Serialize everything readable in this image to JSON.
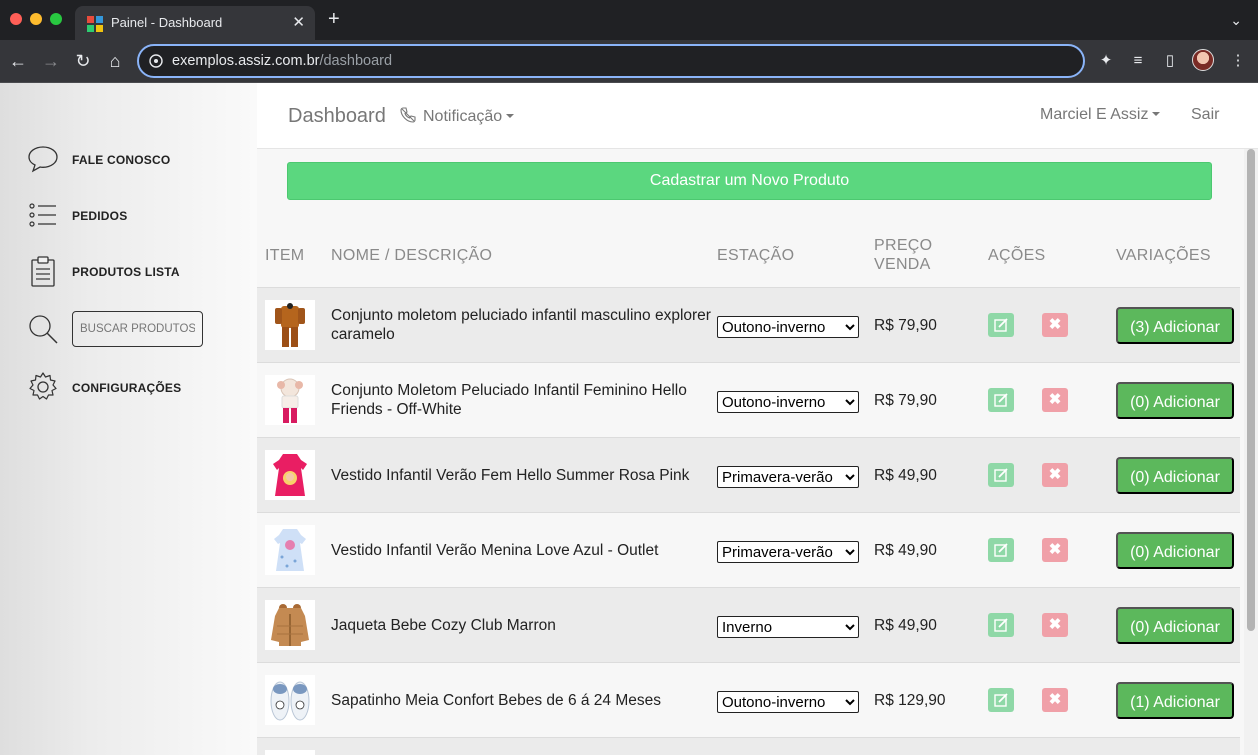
{
  "browser": {
    "tab_title": "Painel - Dashboard",
    "url_host": "exemplos.assiz.com.br",
    "url_path": "/dashboard"
  },
  "sidebar": {
    "items": [
      {
        "label": "FALE CONOSCO",
        "icon": "chat-bubble-icon"
      },
      {
        "label": "PEDIDOS",
        "icon": "list-icon"
      },
      {
        "label": "PRODUTOS LISTA",
        "icon": "clipboard-icon"
      },
      {
        "label": "CONFIGURAÇÕES",
        "icon": "gear-icon"
      }
    ],
    "search_placeholder": "BUSCAR PRODUTOS..."
  },
  "navbar": {
    "brand": "Dashboard",
    "notification_label": "Notificação",
    "user_label": "Marciel E Assiz",
    "logout_label": "Sair"
  },
  "cta_label": "Cadastrar um Novo Produto",
  "table": {
    "headers": {
      "item": "ITEM",
      "name": "NOME / DESCRIÇÃO",
      "season": "ESTAÇÃO",
      "price_line1": "PREÇO",
      "price_line2": "VENDA",
      "actions": "AÇÕES",
      "variations": "VARIAÇÕES"
    },
    "rows": [
      {
        "name": "Conjunto moletom peluciado infantil masculino explorer caramelo",
        "season": "Outono-inverno",
        "price": "R$ 79,90",
        "variations": "(3) Adicionar"
      },
      {
        "name": "Conjunto Moletom Peluciado Infantil Feminino Hello Friends - Off-White",
        "season": "Outono-inverno",
        "price": "R$ 79,90",
        "variations": "(0) Adicionar"
      },
      {
        "name": "Vestido Infantil Verão Fem Hello Summer Rosa Pink",
        "season": "Primavera-verão",
        "price": "R$ 49,90",
        "variations": "(0) Adicionar"
      },
      {
        "name": "Vestido Infantil Verão Menina Love Azul - Outlet",
        "season": "Primavera-verão",
        "price": "R$ 49,90",
        "variations": "(0) Adicionar"
      },
      {
        "name": "Jaqueta Bebe Cozy Club Marron",
        "season": "Inverno",
        "price": "R$ 49,90",
        "variations": "(0) Adicionar"
      },
      {
        "name": "Sapatinho Meia Confort Bebes de 6 á 24 Meses",
        "season": "Outono-inverno",
        "price": "R$ 129,90",
        "variations": "(1) Adicionar"
      }
    ]
  },
  "colors": {
    "cta": "#5bd77f",
    "variation_button": "#5cb85c",
    "edit_button": "#8fd8a7",
    "delete_button": "#f0a0a8"
  }
}
